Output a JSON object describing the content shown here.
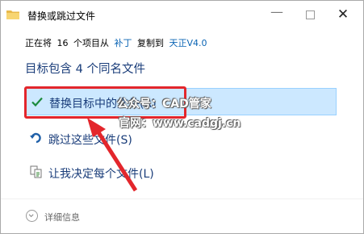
{
  "window": {
    "title": "替换或跳过文件",
    "minimize_label": "—",
    "maximize_label": "",
    "close_label": "✕"
  },
  "progress": {
    "prefix": "正在将",
    "count": "16",
    "mid": "个项目从",
    "source": "补丁",
    "copied_to": "复制到",
    "destination": "天正V4.0"
  },
  "heading": "目标包含 4 个同名文件",
  "options": [
    {
      "label": "替换目标中的文件(R)",
      "icon": "check-icon"
    },
    {
      "label": "跳过这些文件(S)",
      "icon": "skip-arrow-icon"
    },
    {
      "label": "让我决定每个文件(L)",
      "icon": "compare-files-icon"
    }
  ],
  "watermark": {
    "line1": "公众号：CAD管家",
    "line2": "官网：www.cadgj.cn"
  },
  "details_label": "详细信息",
  "colors": {
    "selected_bg": "#cce8ff",
    "selected_border": "#99d1ff",
    "annotation_red": "#e3262c",
    "heading_blue": "#1a3d7a",
    "link_blue": "#0a64b4"
  }
}
